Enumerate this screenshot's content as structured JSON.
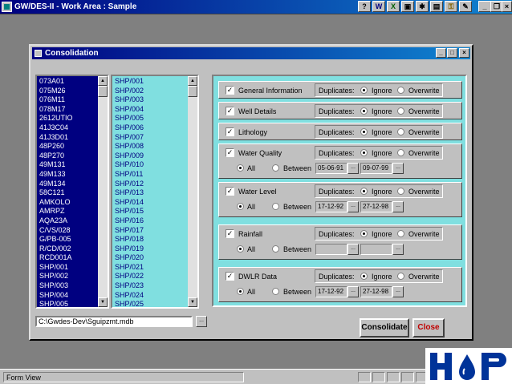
{
  "app": {
    "title": "GW/DES-II - Work Area : Sample",
    "toolbar_icons": [
      "help-icon",
      "word-icon",
      "excel-icon",
      "window-icon",
      "tools-icon",
      "chart-icon",
      "key-icon",
      "edit-icon"
    ],
    "window_controls": [
      "_",
      "□",
      "×"
    ]
  },
  "status": {
    "text": "Form View"
  },
  "dialog": {
    "title": "Consolidation",
    "left_list": [
      "073A01",
      "075M26",
      "076M11",
      "078M17",
      "2612UTIO",
      "41J3C04",
      "41J3D01",
      "48P260",
      "48P270",
      "49M131",
      "49M133",
      "49M134",
      "58C121",
      "AMKOLO",
      "AMRPZ",
      "AQA23A",
      "C/VS/028",
      "G/PB-005",
      "R/CD/002",
      "RCD001A",
      "SHP/001",
      "SHP/002",
      "SHP/003",
      "SHP/004",
      "SHP/005"
    ],
    "right_list": [
      "SHP/001",
      "SHP/002",
      "SHP/003",
      "SHP/004",
      "SHP/005",
      "SHP/006",
      "SHP/007",
      "SHP/008",
      "SHP/009",
      "SHP/010",
      "SHP/011",
      "SHP/012",
      "SHP/013",
      "SHP/014",
      "SHP/015",
      "SHP/016",
      "SHP/017",
      "SHP/018",
      "SHP/019",
      "SHP/020",
      "SHP/021",
      "SHP/022",
      "SHP/023",
      "SHP/024",
      "SHP/025"
    ],
    "path": "C:\\Gwdes-Dev\\Sguipzmt.mdb",
    "dup_label": "Duplicates:",
    "ignore_label": "Ignore",
    "overwrite_label": "Overwrite",
    "all_label": "All",
    "between_label": "Between",
    "groups": {
      "general": {
        "label": "General Information"
      },
      "well": {
        "label": "Well Details"
      },
      "litho": {
        "label": "Lithology"
      },
      "wq": {
        "label": "Water Quality",
        "from": "05-06-91",
        "to": "09-07-99"
      },
      "wl": {
        "label": "Water Level",
        "from": "17-12-92",
        "to": "27-12-98"
      },
      "rain": {
        "label": "Rainfall",
        "from": "",
        "to": ""
      },
      "dwlr": {
        "label": "DWLR Data",
        "from": "17-12-92",
        "to": "27-12-98"
      }
    },
    "consolidate_label": "Consolidate",
    "close_label": "Close"
  },
  "colors": {
    "title_bar": "#000080",
    "panel": "#80dfe0",
    "close_text": "#c00000"
  }
}
